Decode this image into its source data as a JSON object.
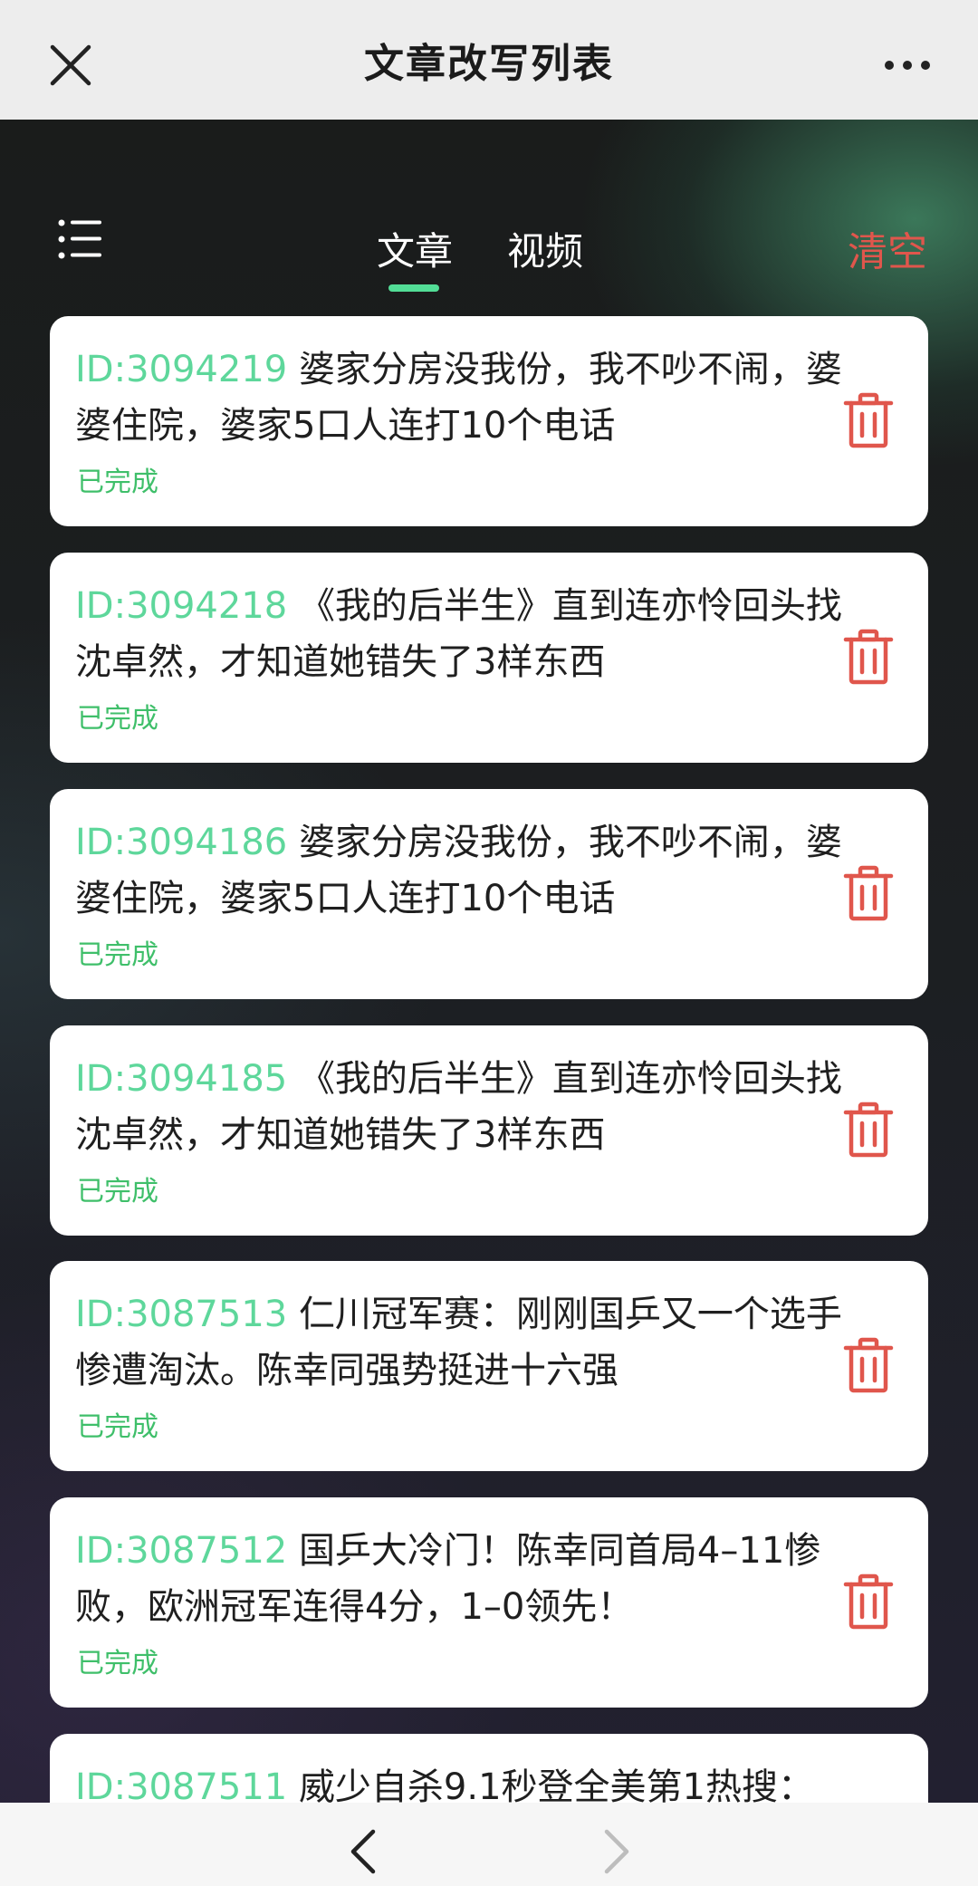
{
  "header": {
    "title": "文章改写列表",
    "close_icon": "close-icon",
    "more_icon": "more-icon"
  },
  "tabs": {
    "menu_icon": "list-menu-icon",
    "items": [
      {
        "label": "文章",
        "active": true
      },
      {
        "label": "视频",
        "active": false
      }
    ],
    "clear_label": "清空"
  },
  "colors": {
    "accent": "#52dd96",
    "id_color": "#5ed79b",
    "status_color": "#3fbf6a",
    "danger": "#e0564c"
  },
  "articles": [
    {
      "id": "ID:3094219",
      "title": "婆家分房没我份，我不吵不闹，婆婆住院，婆家5口人连打10个电话",
      "status": "已完成"
    },
    {
      "id": "ID:3094218",
      "title": "《我的后半生》直到连亦怜回头找沈卓然，才知道她错失了3样东西",
      "status": "已完成"
    },
    {
      "id": "ID:3094186",
      "title": "婆家分房没我份，我不吵不闹，婆婆住院，婆家5口人连打10个电话",
      "status": "已完成"
    },
    {
      "id": "ID:3094185",
      "title": "《我的后半生》直到连亦怜回头找沈卓然，才知道她错失了3样东西",
      "status": "已完成"
    },
    {
      "id": "ID:3087513",
      "title": "仁川冠军赛：刚刚国乒又一个选手惨遭淘汰。陈幸同强势挺进十六强",
      "status": "已完成"
    },
    {
      "id": "ID:3087512",
      "title": "国乒大冷门！陈幸同首局4–11惨败，欧洲冠军连得4分，1–0领先！",
      "status": "已完成"
    },
    {
      "id": "ID:3087511",
      "title": "威少自杀9.1秒登全美第1热搜：",
      "status": ""
    }
  ],
  "bottom_nav": {
    "back_icon": "chevron-left-icon",
    "forward_icon": "chevron-right-icon"
  }
}
